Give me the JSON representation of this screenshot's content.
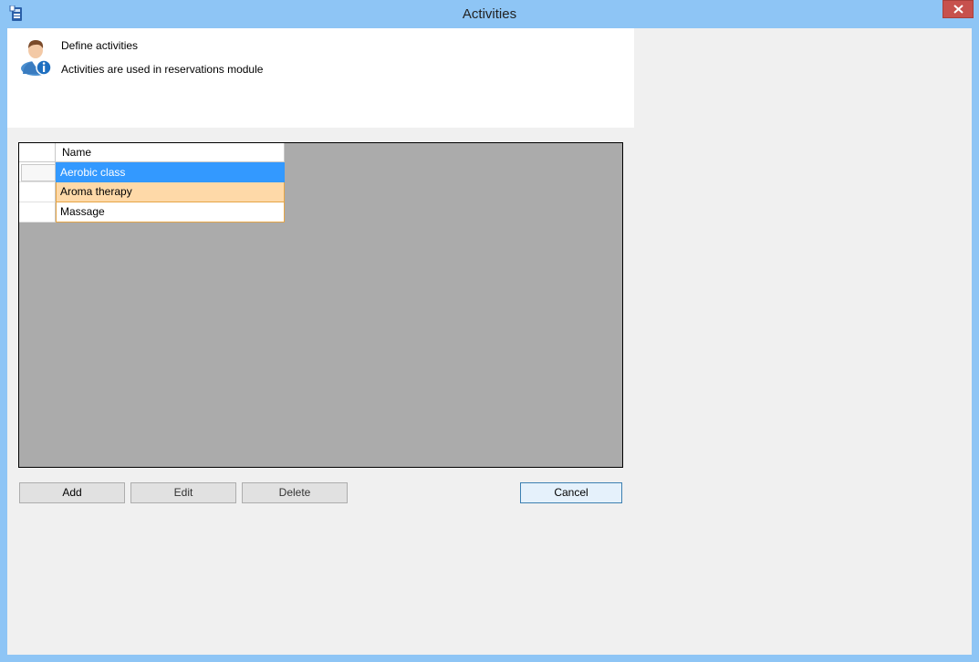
{
  "window": {
    "title": "Activities",
    "accent_color": "#8ec5f5",
    "close_color": "#c7514d"
  },
  "header": {
    "title": "Define activities",
    "subtitle": "Activities  are used in reservations module",
    "icon": "user-info-icon"
  },
  "grid": {
    "columns": [
      "Name"
    ],
    "rows": [
      {
        "name": "Aerobic class",
        "state": "selected"
      },
      {
        "name": "Aroma therapy",
        "state": "alternate"
      },
      {
        "name": "Massage",
        "state": "normal"
      }
    ]
  },
  "buttons": {
    "add": "Add",
    "edit": "Edit",
    "delete": "Delete",
    "cancel": "Cancel"
  }
}
